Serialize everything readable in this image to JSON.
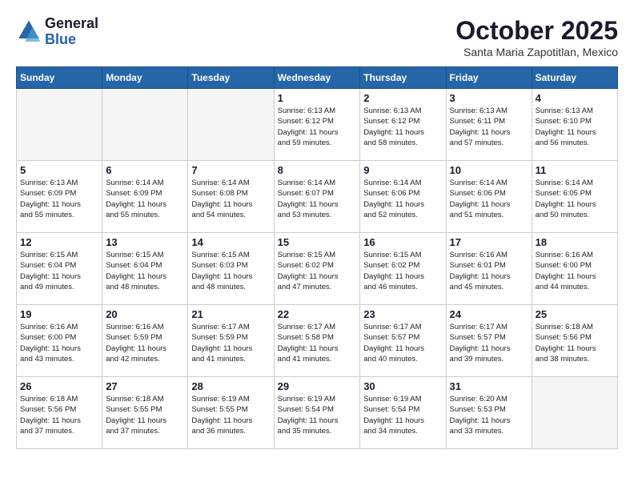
{
  "header": {
    "logo_general": "General",
    "logo_blue": "Blue",
    "month_title": "October 2025",
    "subtitle": "Santa Maria Zapotitlan, Mexico"
  },
  "days_of_week": [
    "Sunday",
    "Monday",
    "Tuesday",
    "Wednesday",
    "Thursday",
    "Friday",
    "Saturday"
  ],
  "weeks": [
    [
      {
        "day": "",
        "info": ""
      },
      {
        "day": "",
        "info": ""
      },
      {
        "day": "",
        "info": ""
      },
      {
        "day": "1",
        "info": "Sunrise: 6:13 AM\nSunset: 6:12 PM\nDaylight: 11 hours\nand 59 minutes."
      },
      {
        "day": "2",
        "info": "Sunrise: 6:13 AM\nSunset: 6:12 PM\nDaylight: 11 hours\nand 58 minutes."
      },
      {
        "day": "3",
        "info": "Sunrise: 6:13 AM\nSunset: 6:11 PM\nDaylight: 11 hours\nand 57 minutes."
      },
      {
        "day": "4",
        "info": "Sunrise: 6:13 AM\nSunset: 6:10 PM\nDaylight: 11 hours\nand 56 minutes."
      }
    ],
    [
      {
        "day": "5",
        "info": "Sunrise: 6:13 AM\nSunset: 6:09 PM\nDaylight: 11 hours\nand 55 minutes."
      },
      {
        "day": "6",
        "info": "Sunrise: 6:14 AM\nSunset: 6:09 PM\nDaylight: 11 hours\nand 55 minutes."
      },
      {
        "day": "7",
        "info": "Sunrise: 6:14 AM\nSunset: 6:08 PM\nDaylight: 11 hours\nand 54 minutes."
      },
      {
        "day": "8",
        "info": "Sunrise: 6:14 AM\nSunset: 6:07 PM\nDaylight: 11 hours\nand 53 minutes."
      },
      {
        "day": "9",
        "info": "Sunrise: 6:14 AM\nSunset: 6:06 PM\nDaylight: 11 hours\nand 52 minutes."
      },
      {
        "day": "10",
        "info": "Sunrise: 6:14 AM\nSunset: 6:06 PM\nDaylight: 11 hours\nand 51 minutes."
      },
      {
        "day": "11",
        "info": "Sunrise: 6:14 AM\nSunset: 6:05 PM\nDaylight: 11 hours\nand 50 minutes."
      }
    ],
    [
      {
        "day": "12",
        "info": "Sunrise: 6:15 AM\nSunset: 6:04 PM\nDaylight: 11 hours\nand 49 minutes."
      },
      {
        "day": "13",
        "info": "Sunrise: 6:15 AM\nSunset: 6:04 PM\nDaylight: 11 hours\nand 48 minutes."
      },
      {
        "day": "14",
        "info": "Sunrise: 6:15 AM\nSunset: 6:03 PM\nDaylight: 11 hours\nand 48 minutes."
      },
      {
        "day": "15",
        "info": "Sunrise: 6:15 AM\nSunset: 6:02 PM\nDaylight: 11 hours\nand 47 minutes."
      },
      {
        "day": "16",
        "info": "Sunrise: 6:15 AM\nSunset: 6:02 PM\nDaylight: 11 hours\nand 46 minutes."
      },
      {
        "day": "17",
        "info": "Sunrise: 6:16 AM\nSunset: 6:01 PM\nDaylight: 11 hours\nand 45 minutes."
      },
      {
        "day": "18",
        "info": "Sunrise: 6:16 AM\nSunset: 6:00 PM\nDaylight: 11 hours\nand 44 minutes."
      }
    ],
    [
      {
        "day": "19",
        "info": "Sunrise: 6:16 AM\nSunset: 6:00 PM\nDaylight: 11 hours\nand 43 minutes."
      },
      {
        "day": "20",
        "info": "Sunrise: 6:16 AM\nSunset: 5:59 PM\nDaylight: 11 hours\nand 42 minutes."
      },
      {
        "day": "21",
        "info": "Sunrise: 6:17 AM\nSunset: 5:59 PM\nDaylight: 11 hours\nand 41 minutes."
      },
      {
        "day": "22",
        "info": "Sunrise: 6:17 AM\nSunset: 5:58 PM\nDaylight: 11 hours\nand 41 minutes."
      },
      {
        "day": "23",
        "info": "Sunrise: 6:17 AM\nSunset: 5:57 PM\nDaylight: 11 hours\nand 40 minutes."
      },
      {
        "day": "24",
        "info": "Sunrise: 6:17 AM\nSunset: 5:57 PM\nDaylight: 11 hours\nand 39 minutes."
      },
      {
        "day": "25",
        "info": "Sunrise: 6:18 AM\nSunset: 5:56 PM\nDaylight: 11 hours\nand 38 minutes."
      }
    ],
    [
      {
        "day": "26",
        "info": "Sunrise: 6:18 AM\nSunset: 5:56 PM\nDaylight: 11 hours\nand 37 minutes."
      },
      {
        "day": "27",
        "info": "Sunrise: 6:18 AM\nSunset: 5:55 PM\nDaylight: 11 hours\nand 37 minutes."
      },
      {
        "day": "28",
        "info": "Sunrise: 6:19 AM\nSunset: 5:55 PM\nDaylight: 11 hours\nand 36 minutes."
      },
      {
        "day": "29",
        "info": "Sunrise: 6:19 AM\nSunset: 5:54 PM\nDaylight: 11 hours\nand 35 minutes."
      },
      {
        "day": "30",
        "info": "Sunrise: 6:19 AM\nSunset: 5:54 PM\nDaylight: 11 hours\nand 34 minutes."
      },
      {
        "day": "31",
        "info": "Sunrise: 6:20 AM\nSunset: 5:53 PM\nDaylight: 11 hours\nand 33 minutes."
      },
      {
        "day": "",
        "info": ""
      }
    ]
  ]
}
